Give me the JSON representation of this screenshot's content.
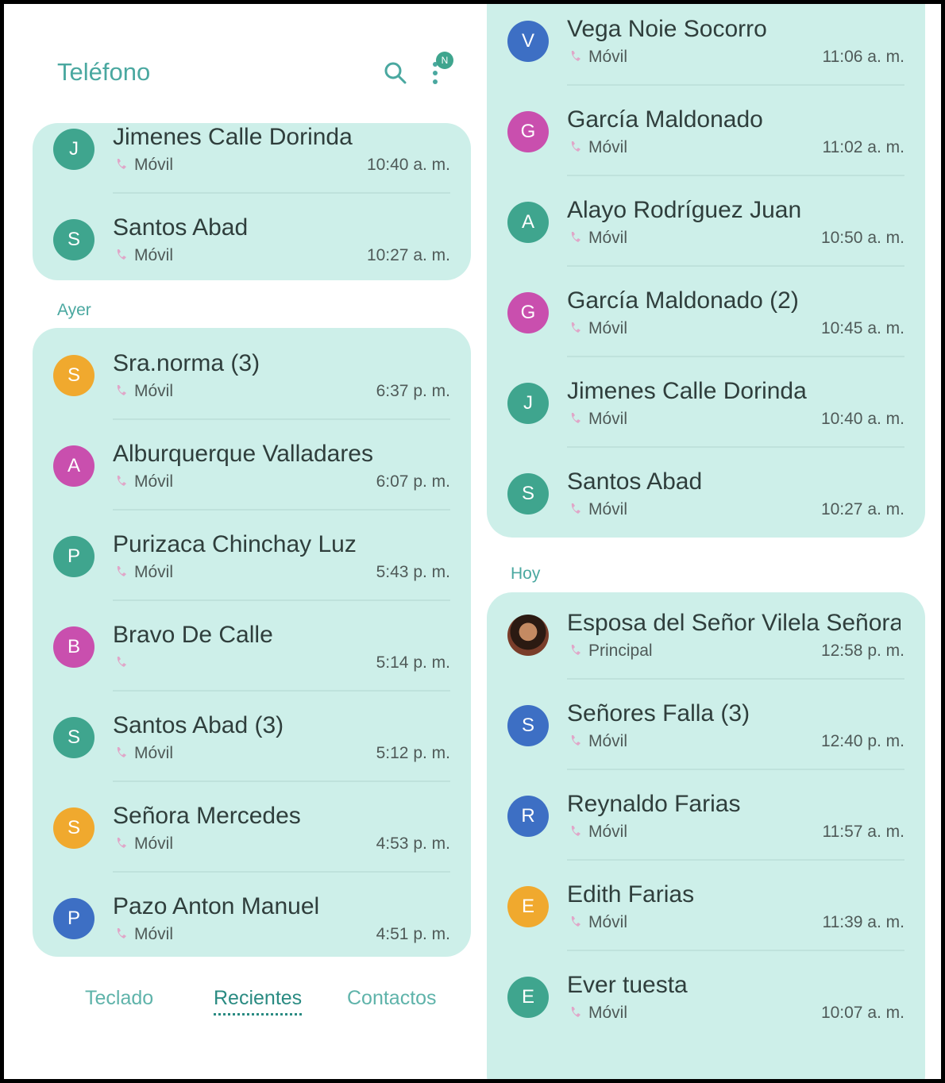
{
  "app": {
    "title": "Teléfono",
    "badge": "N"
  },
  "tabs": [
    "Teclado",
    "Recientes",
    "Contactos"
  ],
  "left": {
    "card_top": [
      {
        "initial": "J",
        "name": "Jimenes Calle Dorinda",
        "type": "Móvil",
        "time": "10:40 a. m.",
        "color": "#3fa58e"
      },
      {
        "initial": "S",
        "name": "Santos Abad",
        "type": "Móvil",
        "time": "10:27 a. m.",
        "color": "#3fa58e"
      }
    ],
    "section": "Ayer",
    "card_ayer": [
      {
        "initial": "S",
        "name": "Sra.norma (3)",
        "type": "Móvil",
        "time": "6:37 p. m.",
        "color": "#f0a92e"
      },
      {
        "initial": "A",
        "name": "Alburquerque Valladares",
        "type": "Móvil",
        "time": "6:07 p. m.",
        "color": "#c94fae"
      },
      {
        "initial": "P",
        "name": "Purizaca Chinchay Luz",
        "type": "Móvil",
        "time": "5:43 p. m.",
        "color": "#3fa58e"
      },
      {
        "initial": "B",
        "name": "Bravo De Calle",
        "type": "",
        "time": "5:14 p. m.",
        "color": "#c94fae"
      },
      {
        "initial": "S",
        "name": "Santos Abad (3)",
        "type": "Móvil",
        "time": "5:12 p. m.",
        "color": "#3fa58e"
      },
      {
        "initial": "S",
        "name": "Señora Mercedes",
        "type": "Móvil",
        "time": "4:53 p. m.",
        "color": "#f0a92e"
      },
      {
        "initial": "P",
        "name": "Pazo Anton Manuel",
        "type": "Móvil",
        "time": "4:51 p. m.",
        "color": "#3d6fc4"
      }
    ]
  },
  "right": {
    "card_prev": [
      {
        "initial": "V",
        "name": "Vega Noie Socorro",
        "type": "Móvil",
        "time": "11:06 a. m.",
        "color": "#3d6fc4"
      },
      {
        "initial": "G",
        "name": "García Maldonado",
        "type": "Móvil",
        "time": "11:02 a. m.",
        "color": "#c94fae"
      },
      {
        "initial": "A",
        "name": "Alayo Rodríguez Juan",
        "type": "Móvil",
        "time": "10:50 a. m.",
        "color": "#3fa58e"
      },
      {
        "initial": "G",
        "name": "García Maldonado (2)",
        "type": "Móvil",
        "time": "10:45 a. m.",
        "color": "#c94fae"
      },
      {
        "initial": "J",
        "name": "Jimenes Calle Dorinda",
        "type": "Móvil",
        "time": "10:40 a. m.",
        "color": "#3fa58e"
      },
      {
        "initial": "S",
        "name": "Santos Abad",
        "type": "Móvil",
        "time": "10:27 a. m.",
        "color": "#3fa58e"
      }
    ],
    "section": "Hoy",
    "card_hoy": [
      {
        "initial": "",
        "photo": true,
        "name": "Esposa del Señor Vilela Señora F...",
        "type": "Principal",
        "time": "12:58 p. m.",
        "color": "#7a3d2a"
      },
      {
        "initial": "S",
        "name": "Señores Falla (3)",
        "type": "Móvil",
        "time": "12:40 p. m.",
        "color": "#3d6fc4"
      },
      {
        "initial": "R",
        "name": "Reynaldo Farias",
        "type": "Móvil",
        "time": "11:57 a. m.",
        "color": "#3d6fc4"
      },
      {
        "initial": "E",
        "name": "Edith Farias",
        "type": "Móvil",
        "time": "11:39 a. m.",
        "color": "#f0a92e"
      },
      {
        "initial": "E",
        "name": "Ever tuesta",
        "type": "Móvil",
        "time": "10:07 a. m.",
        "color": "#3fa58e"
      }
    ]
  }
}
